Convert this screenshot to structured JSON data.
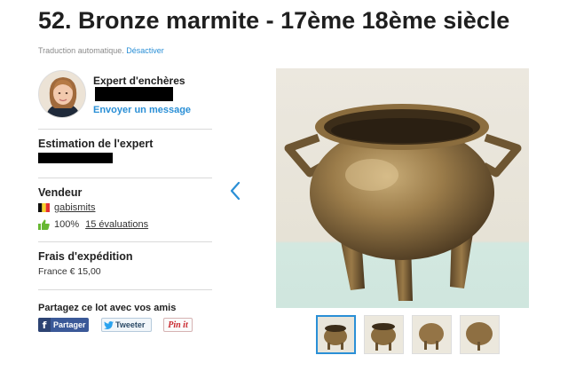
{
  "lot": {
    "title": "52. Bronze marmite - 17ème 18ème siècle"
  },
  "translation": {
    "note": "Traduction automatique.",
    "disable_label": "Désactiver"
  },
  "expert": {
    "heading": "Expert d'enchères",
    "contact_link": "Envoyer un message"
  },
  "estimate": {
    "heading": "Estimation de l'expert"
  },
  "seller": {
    "heading": "Vendeur",
    "username": "gabismits",
    "rating": "100%",
    "reviews": "15 évaluations",
    "country_flag": "flag-belgium-icon",
    "positive_icon": "thumbs-up-icon"
  },
  "shipping": {
    "heading": "Frais d'expédition",
    "value": "France € 15,00"
  },
  "share": {
    "heading": "Partagez ce lot avec vos amis",
    "facebook_label": "Partager",
    "twitter_label": "Tweeter",
    "pinterest_label": "Pin it"
  },
  "colors": {
    "link": "#2a8fd6",
    "facebook": "#3b5998",
    "positive": "#67b832",
    "pinterest": "#c9272d"
  }
}
